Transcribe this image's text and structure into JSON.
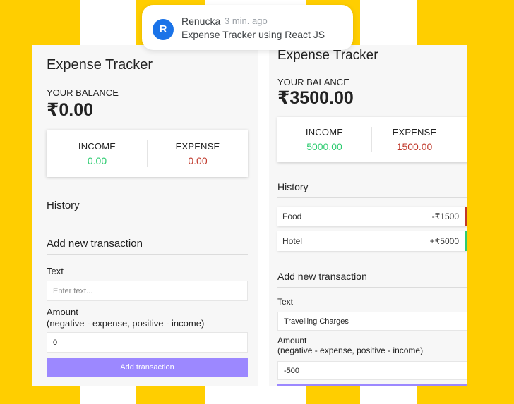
{
  "notification": {
    "avatar_letter": "R",
    "author": "Renucka",
    "time": "3 min. ago",
    "message": "Expense Tracker using React JS"
  },
  "left_app": {
    "title": "Expense Tracker",
    "balance_label": "YOUR BALANCE",
    "balance_value": "₹0.00",
    "income_label": "INCOME",
    "income_value": "0.00",
    "expense_label": "EXPENSE",
    "expense_value": "0.00",
    "history_heading": "History",
    "add_heading": "Add new transaction",
    "text_label": "Text",
    "text_placeholder": "Enter text...",
    "amount_label": "Amount",
    "amount_hint": "(negative - expense, positive - income)",
    "amount_value": "0",
    "add_button": "Add transaction"
  },
  "right_app": {
    "title": "Expense Tracker",
    "balance_label": "YOUR BALANCE",
    "balance_value": "₹3500.00",
    "income_label": "INCOME",
    "income_value": "5000.00",
    "expense_label": "EXPENSE",
    "expense_value": "1500.00",
    "history_heading": "History",
    "history": [
      {
        "name": "Food",
        "amount": "-₹1500",
        "type": "expense"
      },
      {
        "name": "Hotel",
        "amount": "+₹5000",
        "type": "income"
      }
    ],
    "add_heading": "Add new transaction",
    "text_label": "Text",
    "text_value": "Travelling Charges",
    "amount_label": "Amount",
    "amount_hint": "(negative - expense, positive - income)",
    "amount_value": "-500"
  },
  "colors": {
    "background_stripe": "#ffce00",
    "income": "#2ecc71",
    "expense": "#c0392b",
    "button": "#9c88ff",
    "avatar": "#1a73e8"
  }
}
